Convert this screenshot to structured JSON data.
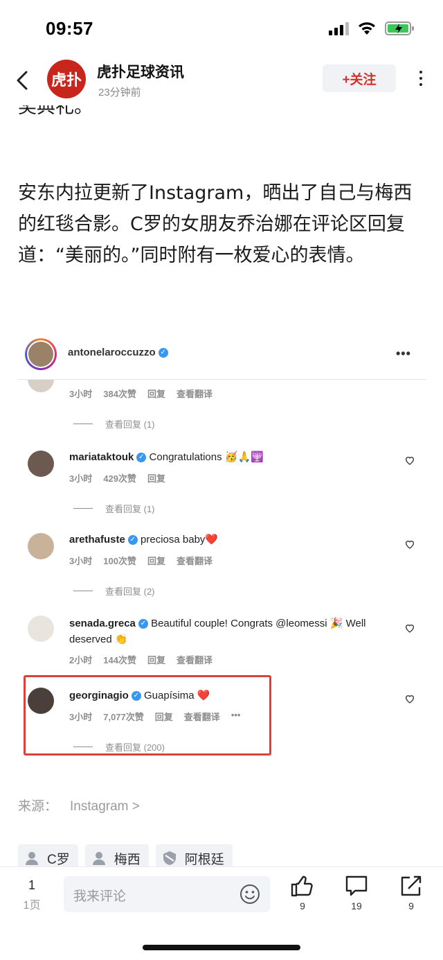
{
  "status_bar": {
    "time": "09:57"
  },
  "header": {
    "account_logo_text": "虎扑",
    "account_name": "虎扑足球资讯",
    "post_time": "23分钟前",
    "follow_label": "+关注"
  },
  "article": {
    "para_top": "奖典礼。",
    "para_main": "安东内拉更新了Instagram，晒出了自己与梅西的红毯合影。C罗的女朋友乔治娜在评论区回复道：“美丽的。”同时附有一枚爱心的表情。"
  },
  "instagram": {
    "poster": "antonelaroccuzzo",
    "comments": [
      {
        "user": "",
        "text": "",
        "time": "3小时",
        "likes": "384次赞",
        "reply": "回复",
        "translate": "查看翻译",
        "replies": "查看回复 (1)"
      },
      {
        "user": "mariataktouk",
        "text": "Congratulations 🥳🙏🕎",
        "time": "3小时",
        "likes": "429次赞",
        "reply": "回复",
        "translate": "",
        "replies": "查看回复 (1)"
      },
      {
        "user": "arethafuste",
        "text": "preciosa baby❤️",
        "time": "3小时",
        "likes": "100次赞",
        "reply": "回复",
        "translate": "查看翻译",
        "replies": "查看回复 (2)"
      },
      {
        "user": "senada.greca",
        "text": "Beautiful couple! Congrats @leomessi 🎉 Well deserved 👏",
        "time": "2小时",
        "likes": "144次赞",
        "reply": "回复",
        "translate": "查看翻译",
        "replies": ""
      },
      {
        "user": "georginagio",
        "text": "Guapísima ❤️",
        "time": "3小时",
        "likes": "7,077次赞",
        "reply": "回复",
        "translate": "查看翻译",
        "replies": "查看回复 (200)"
      }
    ]
  },
  "source": {
    "label": "来源：",
    "value": "Instagram >"
  },
  "tags": [
    "C罗",
    "梅西",
    "阿根廷"
  ],
  "bottom_bar": {
    "page_number": "1",
    "page_label": "1页",
    "comment_placeholder": "我来评论",
    "like_count": "9",
    "comment_count": "19",
    "share_count": "9"
  }
}
